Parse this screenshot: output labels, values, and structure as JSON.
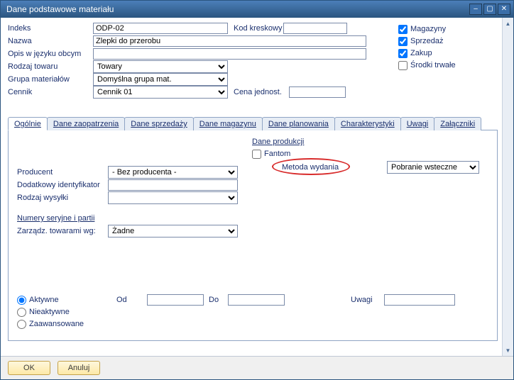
{
  "window": {
    "title": "Dane podstawowe materiału"
  },
  "topform": {
    "indeks_label": "Indeks",
    "indeks_value": "ODP-02",
    "kod_label": "Kod kreskowy",
    "kod_value": "",
    "nazwa_label": "Nazwa",
    "nazwa_value": "Zlepki do przerobu",
    "opis_label": "Opis w języku obcym",
    "opis_value": "",
    "rodzaj_label": "Rodzaj towaru",
    "rodzaj_value": "Towary",
    "grupa_label": "Grupa materiałów",
    "grupa_value": "Domyślna grupa mat.",
    "cennik_label": "Cennik",
    "cennik_value": "Cennik 01",
    "cena_label": "Cena jednost.",
    "cena_value": ""
  },
  "checks": {
    "magazyny": "Magazyny",
    "sprzedaz": "Sprzedaż",
    "zakup": "Zakup",
    "srodki": "Środki trwałe",
    "magazyny_checked": true,
    "sprzedaz_checked": true,
    "zakup_checked": true,
    "srodki_checked": false
  },
  "tabs": {
    "ogolnie": "Ogólnie",
    "zaopatrzenia": "Dane zaopatrzenia",
    "sprzedazy": "Dane sprzedaży",
    "magazynu": "Dane magazynu",
    "planowania": "Dane planowania",
    "charakterystyki": "Charakterystyki",
    "uwagi": "Uwagi",
    "zalaczniki": "Załączniki"
  },
  "panel": {
    "producent_label": "Producent",
    "producent_value": "- Bez producenta -",
    "ident_label": "Dodatkowy identyfikator",
    "ident_value": "",
    "wysylka_label": "Rodzaj wysyłki",
    "wysylka_value": "",
    "numery_title": "Numery seryjne i partii",
    "zarzadz_label": "Zarządz. towarami wg:",
    "zarzadz_value": "Żadne",
    "dane_prod_title": "Dane produkcji",
    "fantom_label": "Fantom",
    "fantom_checked": false,
    "metoda_label": "Metoda wydania",
    "metoda_value": "Pobranie wsteczne"
  },
  "bottom": {
    "aktywne": "Aktywne",
    "nieaktywne": "Nieaktywne",
    "zaawansowane": "Zaawansowane",
    "od": "Od",
    "do": "Do",
    "uwagi": "Uwagi"
  },
  "buttons": {
    "ok": "OK",
    "anuluj": "Anuluj"
  }
}
